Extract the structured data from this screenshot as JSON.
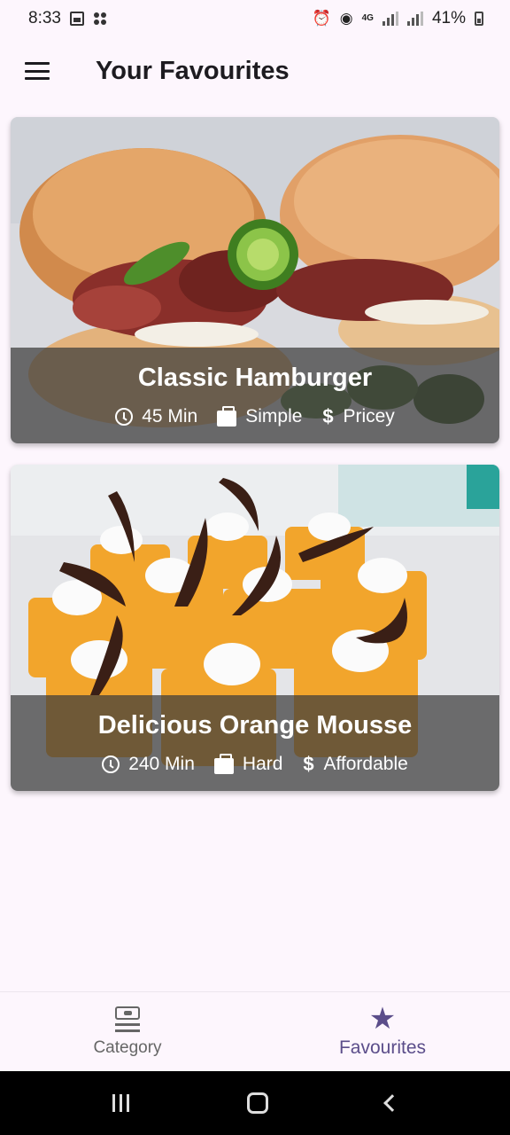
{
  "status_bar": {
    "time": "8:33",
    "network": "4G",
    "battery": "41%"
  },
  "app_bar": {
    "title": "Your Favourites",
    "menu_icon": "hamburger-menu-icon"
  },
  "meals": [
    {
      "title": "Classic Hamburger",
      "duration": "45 Min",
      "complexity": "Simple",
      "affordability": "Pricey"
    },
    {
      "title": "Delicious Orange Mousse",
      "duration": "240 Min",
      "complexity": "Hard",
      "affordability": "Affordable"
    }
  ],
  "bottom_nav": {
    "items": [
      {
        "label": "Category",
        "icon": "category-icon",
        "active": false
      },
      {
        "label": "Favourites",
        "icon": "star-icon",
        "active": true
      }
    ]
  },
  "colors": {
    "background": "#fdf6fd",
    "accent": "#5b4d8a",
    "overlay": "rgba(60,60,60,0.72)"
  }
}
